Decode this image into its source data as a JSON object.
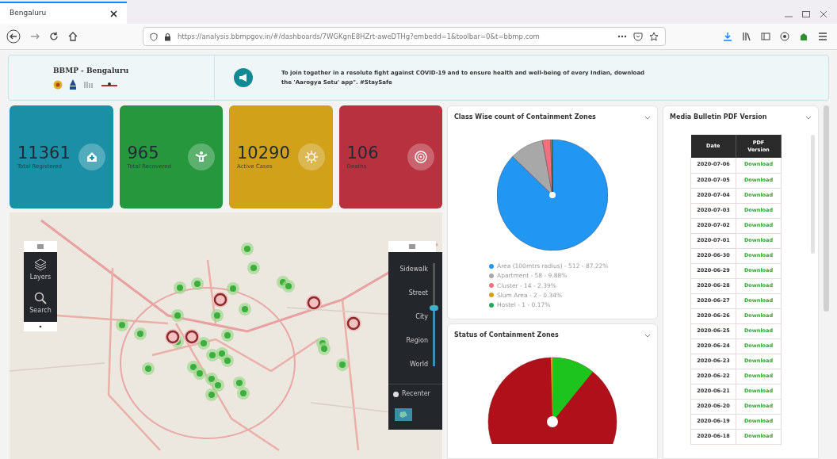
{
  "browser": {
    "tab_title": "Bengaluru",
    "url": "https://analysis.bbmpgov.in/#/dashboards/7WGKgnE8HZrt-aweDTHg?embedd=1&toolbar=0&t=bbmp.com"
  },
  "banner": {
    "brand": "BBMP - Bengaluru",
    "message": "To join together in a resolute fight against COVID-19 and to ensure health and well-being of every Indian, download the 'Aarogya Setu' app\". #StaySafe"
  },
  "stats": [
    {
      "kind": "registered",
      "value": "11361",
      "label": "Total Registered",
      "color": "#1a8fa6"
    },
    {
      "kind": "recovered",
      "value": "965",
      "label": "Total Recovered",
      "color": "#27973e"
    },
    {
      "kind": "active",
      "value": "10290",
      "label": "Active Cases",
      "color": "#d1a11a"
    },
    {
      "kind": "deaths",
      "value": "106",
      "label": "Deaths",
      "color": "#b8313f"
    }
  ],
  "map": {
    "tools": [
      {
        "kind": "layers",
        "label": "Layers"
      },
      {
        "kind": "search",
        "label": "Search"
      }
    ],
    "zoom": {
      "stops": [
        "Sidewalk",
        "Street",
        "City",
        "Region",
        "World"
      ],
      "level": 0.56
    },
    "toggle": {
      "label": "Recenter",
      "on": false
    }
  },
  "class_chart": {
    "title": "Class Wise count of Containment Zones",
    "chart_data": {
      "type": "pie",
      "categories": [
        "Area (100mtrs radius) - 512 - 87.22%",
        "Apartment - 58 - 9.88%",
        "Cluster - 14 - 2.39%",
        "Slum Area - 2 - 0.34%",
        "Hostel - 1 - 0.17%"
      ],
      "values": [
        87.22,
        9.88,
        2.39,
        0.34,
        0.17
      ],
      "legend": "bottom",
      "colors": [
        "#2196f3",
        "#a8a8a8",
        "#f07080",
        "#d4a017",
        "#22aa55"
      ]
    }
  },
  "status_chart": {
    "title": "Status of Containment Zones"
  },
  "bulletin": {
    "title": "Media Bulletin PDF Version",
    "columns": [
      "Date",
      "PDF Version"
    ],
    "rows": [
      {
        "date": "2020-07-06",
        "link": "Download"
      },
      {
        "date": "2020-07-05",
        "link": "Download"
      },
      {
        "date": "2020-07-04",
        "link": "Download"
      },
      {
        "date": "2020-07-03",
        "link": "Download"
      },
      {
        "date": "2020-07-02",
        "link": "Download"
      },
      {
        "date": "2020-07-01",
        "link": "Download"
      },
      {
        "date": "2020-06-30",
        "link": "Download"
      },
      {
        "date": "2020-06-29",
        "link": "Download"
      },
      {
        "date": "2020-06-28",
        "link": "Download"
      },
      {
        "date": "2020-06-27",
        "link": "Download"
      },
      {
        "date": "2020-06-26",
        "link": "Download"
      },
      {
        "date": "2020-06-25",
        "link": "Download"
      },
      {
        "date": "2020-06-24",
        "link": "Download"
      },
      {
        "date": "2020-06-23",
        "link": "Download"
      },
      {
        "date": "2020-06-22",
        "link": "Download"
      },
      {
        "date": "2020-06-21",
        "link": "Download"
      },
      {
        "date": "2020-06-20",
        "link": "Download"
      },
      {
        "date": "2020-06-19",
        "link": "Download"
      },
      {
        "date": "2020-06-18",
        "link": "Download"
      }
    ]
  }
}
